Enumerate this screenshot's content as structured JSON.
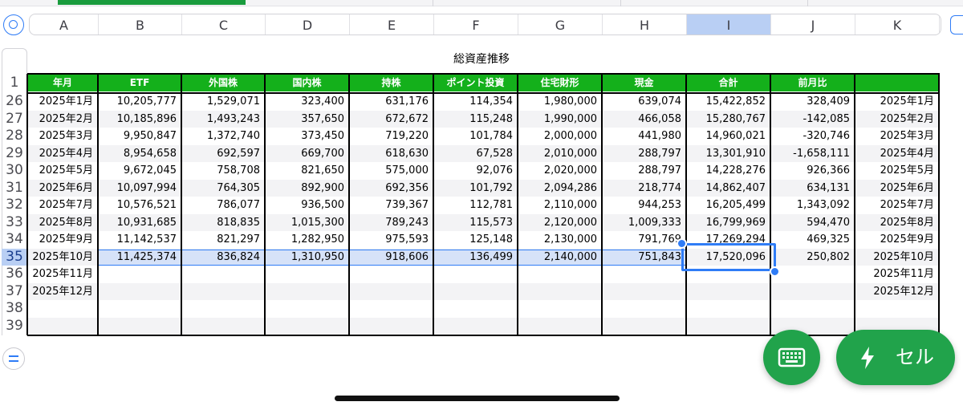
{
  "columns": [
    "A",
    "B",
    "C",
    "D",
    "E",
    "F",
    "G",
    "H",
    "I",
    "J",
    "K"
  ],
  "selected_column": "I",
  "sheet_title": "総資産推移",
  "header_row_number": "1",
  "headers": [
    "年月",
    "ETF",
    "外国株",
    "国内株",
    "持株",
    "ポイント投資",
    "住宅財形",
    "現金",
    "合計",
    "前月比",
    ""
  ],
  "rows": [
    {
      "num": "26",
      "cells": [
        "2025年1月",
        "10,205,777",
        "1,529,071",
        "323,400",
        "631,176",
        "114,354",
        "1,980,000",
        "639,074",
        "15,422,852",
        "328,409",
        "2025年1月"
      ]
    },
    {
      "num": "27",
      "cells": [
        "2025年2月",
        "10,185,896",
        "1,493,243",
        "357,650",
        "672,672",
        "115,248",
        "1,990,000",
        "466,058",
        "15,280,767",
        "-142,085",
        "2025年2月"
      ]
    },
    {
      "num": "28",
      "cells": [
        "2025年3月",
        "9,950,847",
        "1,372,740",
        "373,450",
        "719,220",
        "101,784",
        "2,000,000",
        "441,980",
        "14,960,021",
        "-320,746",
        "2025年3月"
      ]
    },
    {
      "num": "29",
      "cells": [
        "2025年4月",
        "8,954,658",
        "692,597",
        "669,700",
        "618,630",
        "67,528",
        "2,010,000",
        "288,797",
        "13,301,910",
        "-1,658,111",
        "2025年4月"
      ]
    },
    {
      "num": "30",
      "cells": [
        "2025年5月",
        "9,672,045",
        "758,708",
        "821,650",
        "575,000",
        "92,076",
        "2,020,000",
        "288,797",
        "14,228,276",
        "926,366",
        "2025年5月"
      ]
    },
    {
      "num": "31",
      "cells": [
        "2025年6月",
        "10,097,994",
        "764,305",
        "892,900",
        "692,356",
        "101,792",
        "2,094,286",
        "218,774",
        "14,862,407",
        "634,131",
        "2025年6月"
      ]
    },
    {
      "num": "32",
      "cells": [
        "2025年7月",
        "10,576,521",
        "786,077",
        "936,500",
        "739,367",
        "112,781",
        "2,110,000",
        "944,253",
        "16,205,499",
        "1,343,092",
        "2025年7月"
      ]
    },
    {
      "num": "33",
      "cells": [
        "2025年8月",
        "10,931,685",
        "818,835",
        "1,015,300",
        "789,243",
        "115,573",
        "2,120,000",
        "1,009,333",
        "16,799,969",
        "594,470",
        "2025年8月"
      ]
    },
    {
      "num": "34",
      "cells": [
        "2025年9月",
        "11,142,537",
        "821,297",
        "1,282,950",
        "975,593",
        "125,148",
        "2,130,000",
        "791,769",
        "17,269,294",
        "469,325",
        "2025年9月"
      ]
    },
    {
      "num": "35",
      "cells": [
        "2025年10月",
        "11,425,374",
        "836,824",
        "1,310,950",
        "918,606",
        "136,499",
        "2,140,000",
        "751,843",
        "17,520,096",
        "250,802",
        "2025年10月"
      ]
    },
    {
      "num": "36",
      "cells": [
        "2025年11月",
        "",
        "",
        "",
        "",
        "",
        "",
        "",
        "",
        "",
        "2025年11月"
      ]
    },
    {
      "num": "37",
      "cells": [
        "2025年12月",
        "",
        "",
        "",
        "",
        "",
        "",
        "",
        "",
        "",
        "2025年12月"
      ]
    },
    {
      "num": "38",
      "cells": [
        "",
        "",
        "",
        "",
        "",
        "",
        "",
        "",
        "",
        "",
        ""
      ]
    },
    {
      "num": "39",
      "cells": [
        "",
        "",
        "",
        "",
        "",
        "",
        "",
        "",
        "",
        "",
        ""
      ]
    }
  ],
  "selected_row": "35",
  "selected_cell": "I35",
  "cell_button_label": "セル",
  "icons": {
    "select_all": "circle-icon",
    "formula": "equals-icon",
    "keyboard": "keyboard-icon",
    "quick_action": "lightning-icon"
  },
  "colors": {
    "header_green": "#14b01b",
    "button_green": "#21a34b",
    "selection_blue": "#2f7cf6",
    "selection_fill": "#b9cff4"
  }
}
